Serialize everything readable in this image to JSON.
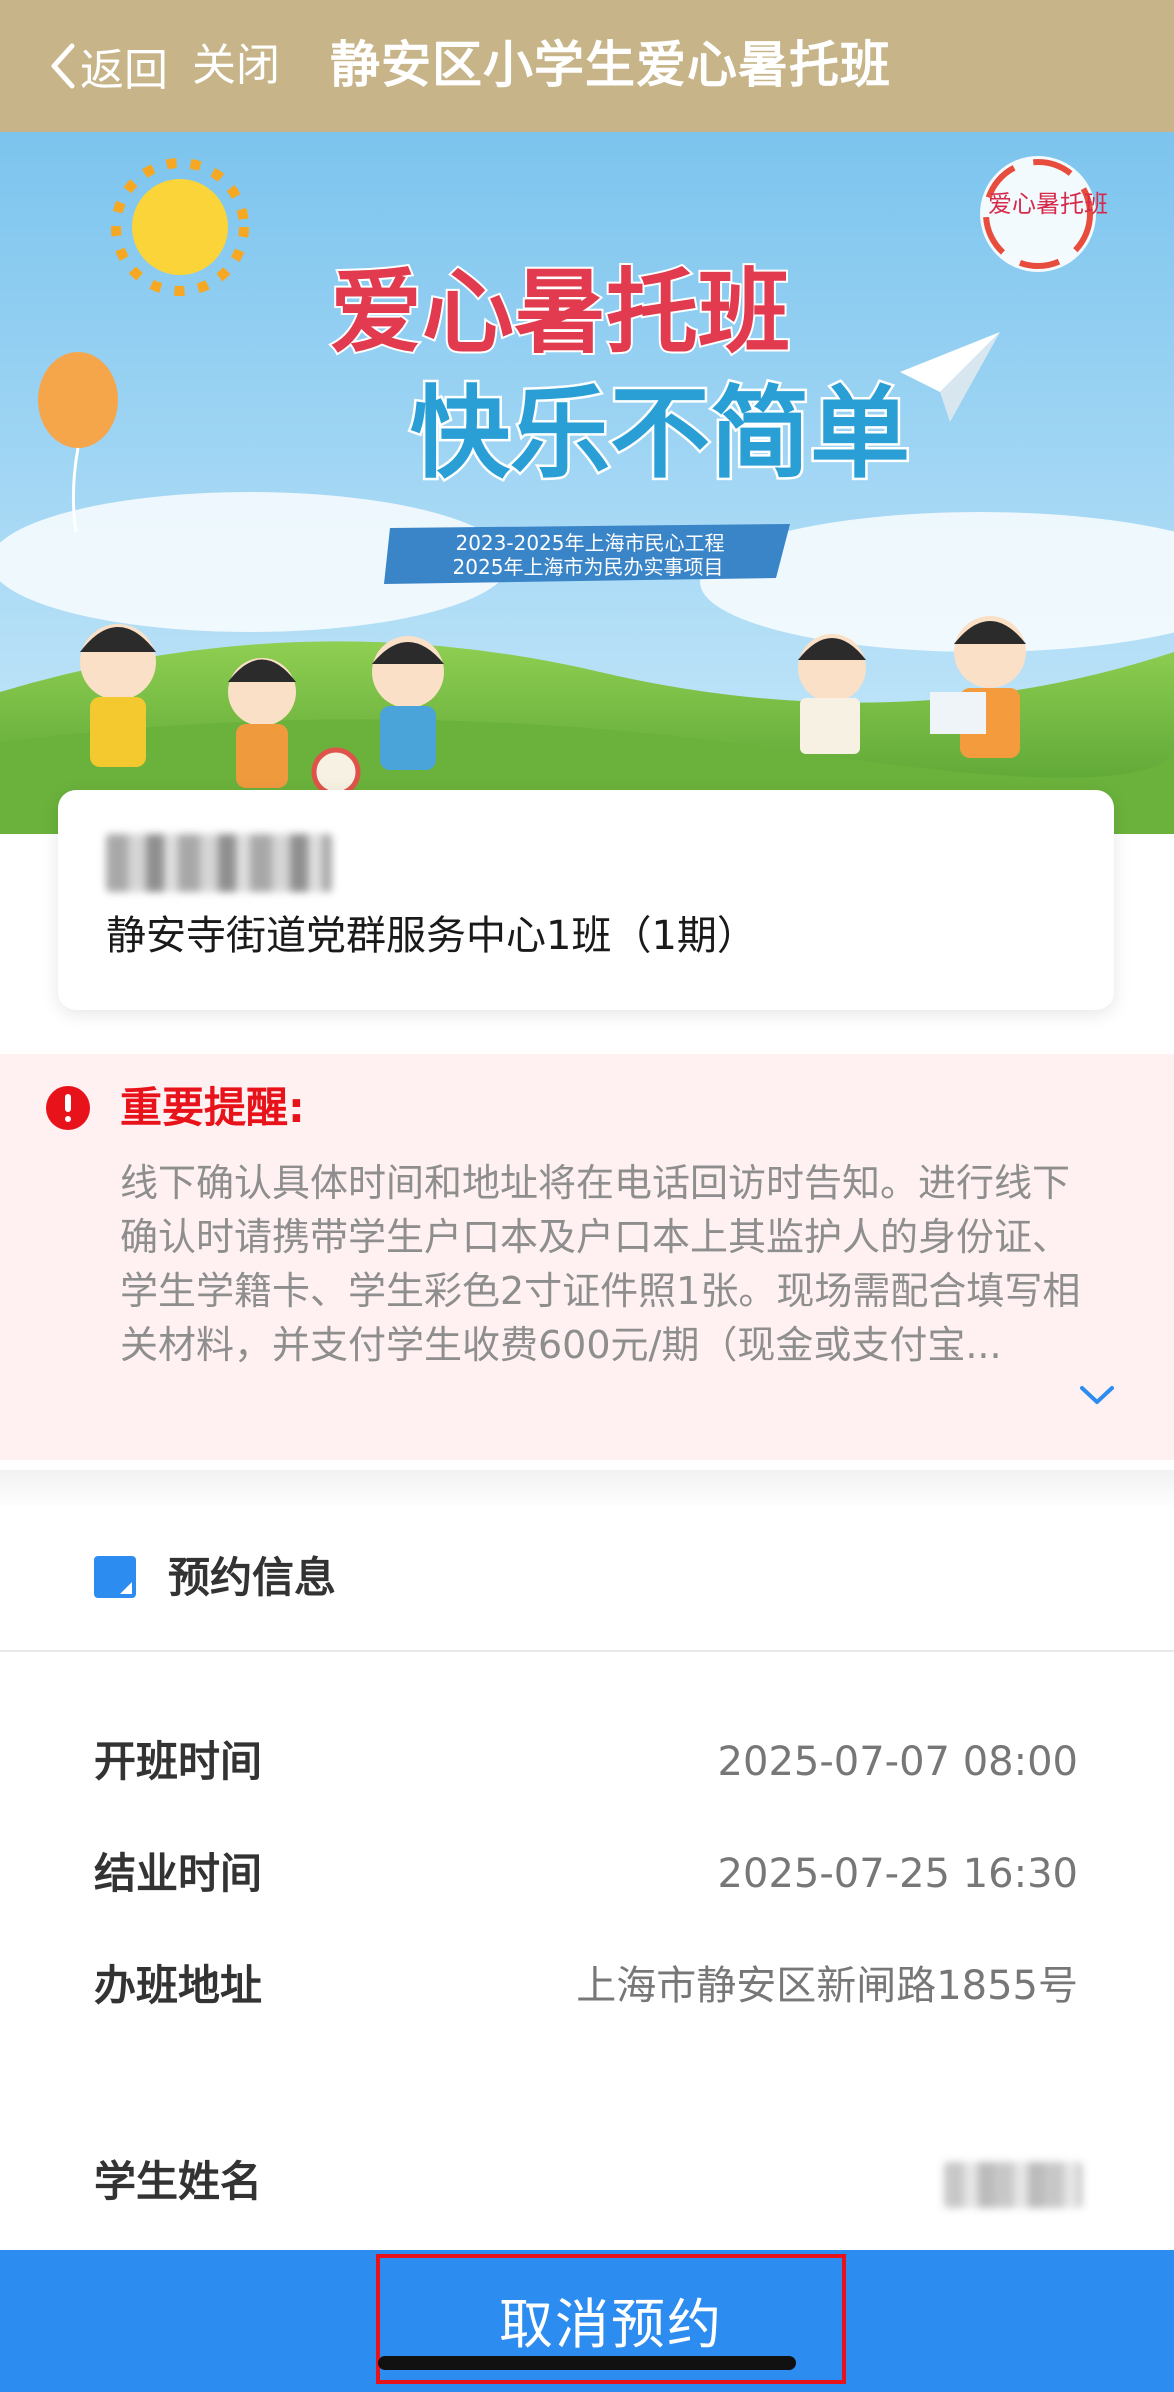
{
  "header": {
    "back_label": "返回",
    "close_label": "关闭",
    "title": "静安区小学生爱心暑托班"
  },
  "banner": {
    "headline_line1": "爱心暑托班",
    "headline_line2": "快乐不简单",
    "ribbon_line1": "2023-2025年上海市民心工程",
    "ribbon_line2": "2025年上海市为民办实事项目",
    "logo_text": "爱心暑托班"
  },
  "info_card": {
    "class_name": "静安寺街道党群服务中心1班（1期）"
  },
  "reminder": {
    "title": "重要提醒:",
    "text": "线下确认具体时间和地址将在电话回访时告知。进行线下确认时请携带学生户口本及户口本上其监护人的身份证、学生学籍卡、学生彩色2寸证件照1张。现场需配合填写相关材料，并支付学生收费600元/期（现金或支付宝...",
    "icon": "exclamation-circle-icon",
    "expand_icon": "chevron-down-icon"
  },
  "appointment": {
    "section_title": "预约信息",
    "rows": [
      {
        "label": "开班时间",
        "value": "2025-07-07 08:00"
      },
      {
        "label": "结业时间",
        "value": "2025-07-25 16:30"
      },
      {
        "label": "办班地址",
        "value": "上海市静安区新闸路1855号"
      },
      {
        "label": "学生姓名",
        "value": ""
      }
    ]
  },
  "footer": {
    "cancel_label": "取消预约"
  },
  "colors": {
    "header_bg": "#c7b589",
    "accent_blue": "#2d8cf0",
    "warning_red": "#e8121b",
    "reminder_bg": "#fff1f1"
  }
}
